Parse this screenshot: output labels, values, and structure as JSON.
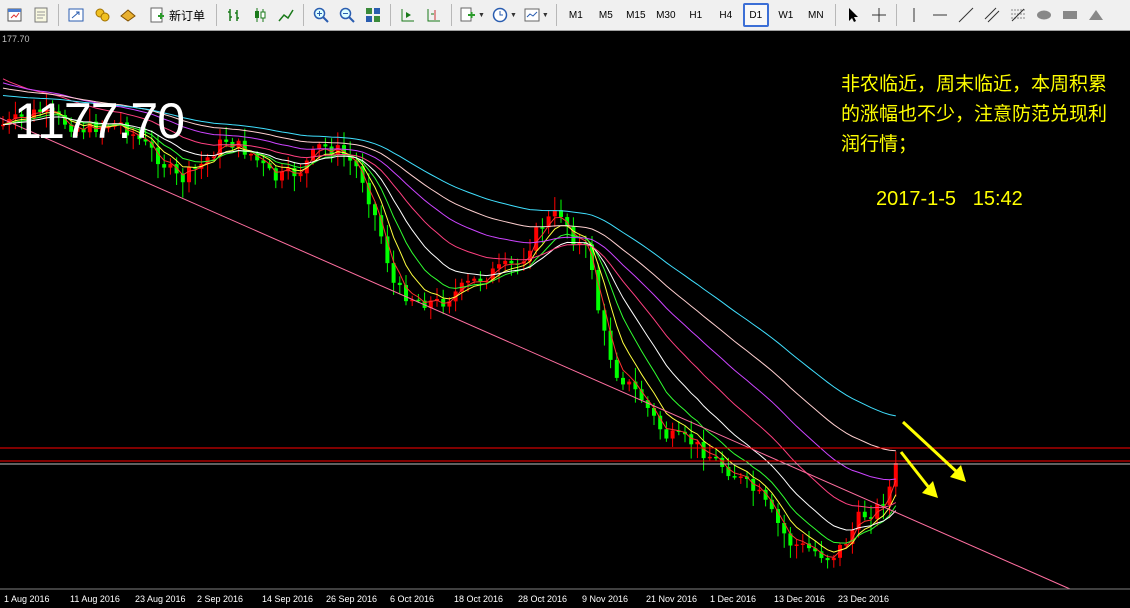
{
  "toolbar": {
    "new_order_label": "新订单",
    "timeframes": [
      "M1",
      "M5",
      "M15",
      "M30",
      "H1",
      "H4",
      "D1",
      "W1",
      "MN"
    ],
    "active_timeframe": "D1"
  },
  "chart": {
    "corner_price": "177.70",
    "bid_price": "1177.70",
    "annotation": "非农临近，周末临近，本周积累的涨幅也不少，注意防范兑现利润行情；",
    "timestamp": "2017-1-5   15:42",
    "x_labels": [
      "1 Aug 2016",
      "11 Aug 2016",
      "23 Aug 2016",
      "2 Sep 2016",
      "14 Sep 2016",
      "26 Sep 2016",
      "6 Oct 2016",
      "18 Oct 2016",
      "28 Oct 2016",
      "9 Nov 2016",
      "21 Nov 2016",
      "1 Dec 2016",
      "13 Dec 2016",
      "23 Dec 2016"
    ],
    "colors": {
      "background": "#000000",
      "bull_candle": "#ff0000",
      "bear_candle": "#00ff00",
      "annotation": "#ffff00",
      "trendline": "#ff6fa0",
      "hline": "#ff0000"
    }
  }
}
